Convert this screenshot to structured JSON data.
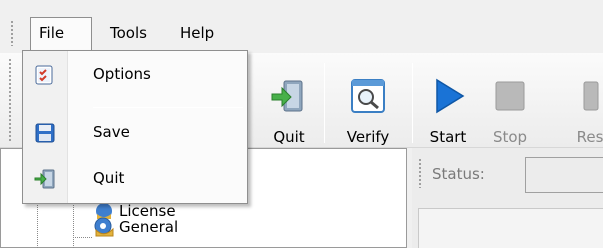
{
  "menubar": {
    "items": [
      {
        "label": "File"
      },
      {
        "label": "Tools"
      },
      {
        "label": "Help"
      }
    ]
  },
  "file_menu": {
    "items": [
      {
        "label": "Options",
        "icon": "options-checklist-icon"
      },
      {
        "label": "Save",
        "icon": "floppy-disk-icon"
      },
      {
        "label": "Quit",
        "icon": "exit-door-icon"
      }
    ]
  },
  "toolbar": {
    "quit_label": "Quit",
    "verify_label": "Verify",
    "start_label": "Start",
    "stop_label": "Stop",
    "reset_label": "Res"
  },
  "tree": {
    "items": [
      {
        "label": "License"
      },
      {
        "label": "General"
      }
    ]
  },
  "status": {
    "label": "Status:",
    "value": ""
  },
  "colors": {
    "play_blue": "#1a73d6",
    "accent_green": "#3aa43a",
    "menu_border": "#8f8f8f"
  }
}
